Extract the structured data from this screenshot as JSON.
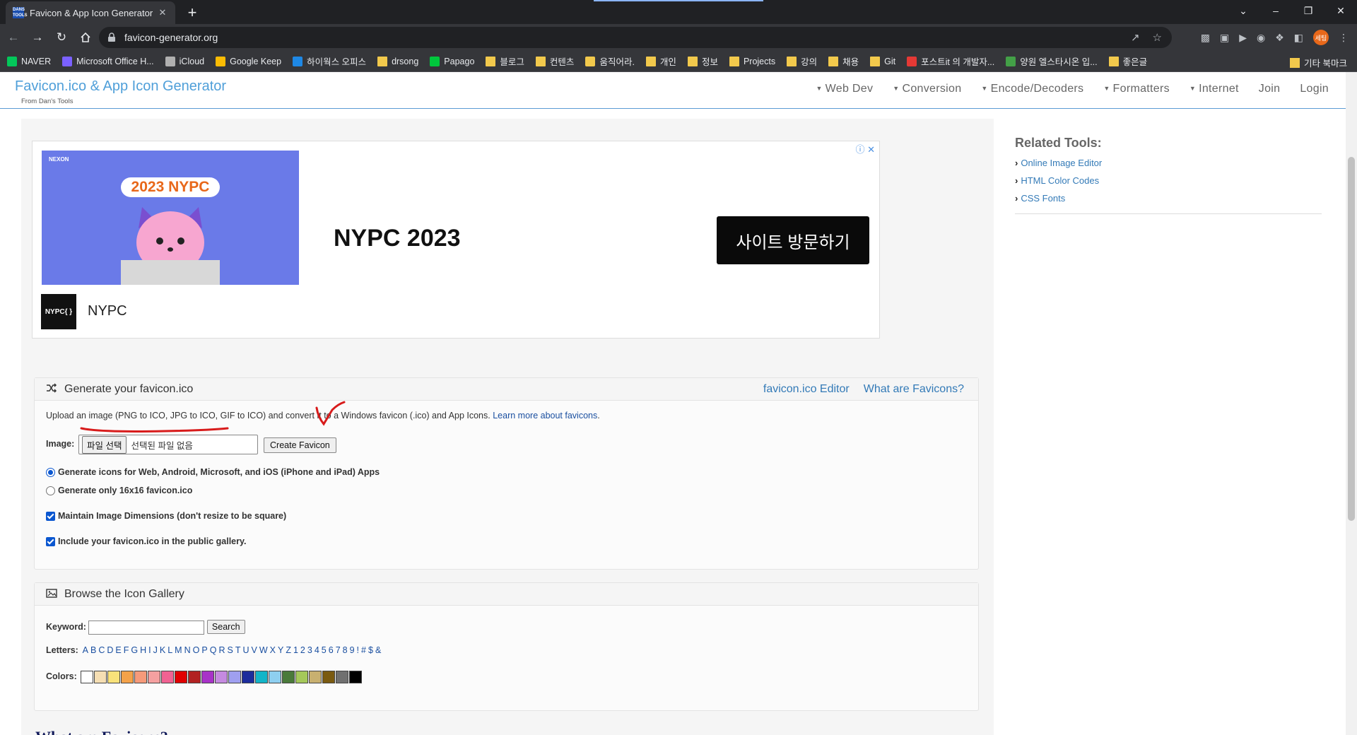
{
  "browser": {
    "tab_title": "Favicon & App Icon Generator",
    "tab_close": "✕",
    "new_tab": "+",
    "tab_icon_text": "DANS TOOLS",
    "url": "favicon-generator.org",
    "profile_label": "세팅",
    "window_controls": {
      "chevron": "⌄",
      "minimize": "–",
      "maximize": "❐",
      "close": "✕"
    }
  },
  "bookmarks": {
    "items": [
      {
        "label": "NAVER",
        "color": "#03c75a"
      },
      {
        "label": "Microsoft Office H...",
        "color": "#7b61ff"
      },
      {
        "label": "iCloud",
        "color": "#b0b0b0"
      },
      {
        "label": "Google Keep",
        "color": "#fbbc04"
      },
      {
        "label": "하이웍스 오피스",
        "color": "#1e88e5"
      },
      {
        "label": "drsong",
        "color": "folder"
      },
      {
        "label": "Papago",
        "color": "#00c73c"
      },
      {
        "label": "블로그",
        "color": "folder"
      },
      {
        "label": "컨텐츠",
        "color": "folder"
      },
      {
        "label": "움직어라.",
        "color": "#f2c94c"
      },
      {
        "label": "개인",
        "color": "folder"
      },
      {
        "label": "정보",
        "color": "folder"
      },
      {
        "label": "Projects",
        "color": "folder"
      },
      {
        "label": "강의",
        "color": "folder"
      },
      {
        "label": "채용",
        "color": "folder"
      },
      {
        "label": "Git",
        "color": "folder"
      },
      {
        "label": "포스트it 의 개발자...",
        "color": "#e53935"
      },
      {
        "label": "양원 엘스타시온 입...",
        "color": "#43a047"
      },
      {
        "label": "좋은글",
        "color": "folder"
      }
    ],
    "other": "기타 북마크"
  },
  "site": {
    "brand": "Favicon.ico & App Icon Generator",
    "brand_sub_prefix": "From",
    "brand_sub_link": "Dan's Tools",
    "nav": [
      "Web Dev",
      "Conversion",
      "Encode/Decoders",
      "Formatters",
      "Internet"
    ],
    "join": "Join",
    "login": "Login"
  },
  "ad": {
    "headline": "NYPC 2023",
    "cta": "사이트 방문하기",
    "brand": "NYPC",
    "logo_text": "NYPC{ }",
    "image_label": "2023 NYPC",
    "image_top": "NEXON"
  },
  "generator": {
    "title": "Generate your favicon.ico",
    "link_editor": "favicon.ico Editor",
    "link_what": "What are Favicons?",
    "description": "Upload an image (PNG to ICO, JPG to ICO, GIF to ICO) and convert it to a Windows favicon (.ico) and App Icons.",
    "learn_more": "Learn more about favicons",
    "image_label": "Image:",
    "file_button": "파일 선택",
    "file_status": "선택된 파일 없음",
    "create_button": "Create Favicon",
    "option_all": "Generate icons for Web, Android, Microsoft, and iOS (iPhone and iPad) Apps",
    "option_16": "Generate only 16x16 favicon.ico",
    "maintain_dims": "Maintain Image Dimensions (don't resize to be square)",
    "public_gallery": "Include your favicon.ico in the public gallery."
  },
  "gallery": {
    "title": "Browse the Icon Gallery",
    "keyword_label": "Keyword:",
    "search_button": "Search",
    "letters_label": "Letters:",
    "letters": [
      "A",
      "B",
      "C",
      "D",
      "E",
      "F",
      "G",
      "H",
      "I",
      "J",
      "K",
      "L",
      "M",
      "N",
      "O",
      "P",
      "Q",
      "R",
      "S",
      "T",
      "U",
      "V",
      "W",
      "X",
      "Y",
      "Z",
      "1",
      "2",
      "3",
      "4",
      "5",
      "6",
      "7",
      "8",
      "9",
      "!",
      "#",
      "$",
      "&"
    ],
    "colors_label": "Colors:",
    "colors": [
      "#ffffff",
      "#f5deb3",
      "#f9e27a",
      "#f4a24a",
      "#f69a7a",
      "#f5a0a0",
      "#f06292",
      "#e00000",
      "#b22222",
      "#a832c8",
      "#c58ae0",
      "#9f9ff0",
      "#1c2c9c",
      "#13b5c8",
      "#8ecff0",
      "#4a7a3a",
      "#a5c85a",
      "#c8b070",
      "#7a5a10",
      "#707070",
      "#000000"
    ]
  },
  "faq": {
    "title": "What are Favicons?"
  },
  "sidebar": {
    "title": "Related Tools:",
    "items": [
      "Online Image Editor",
      "HTML Color Codes",
      "CSS Fonts"
    ]
  }
}
